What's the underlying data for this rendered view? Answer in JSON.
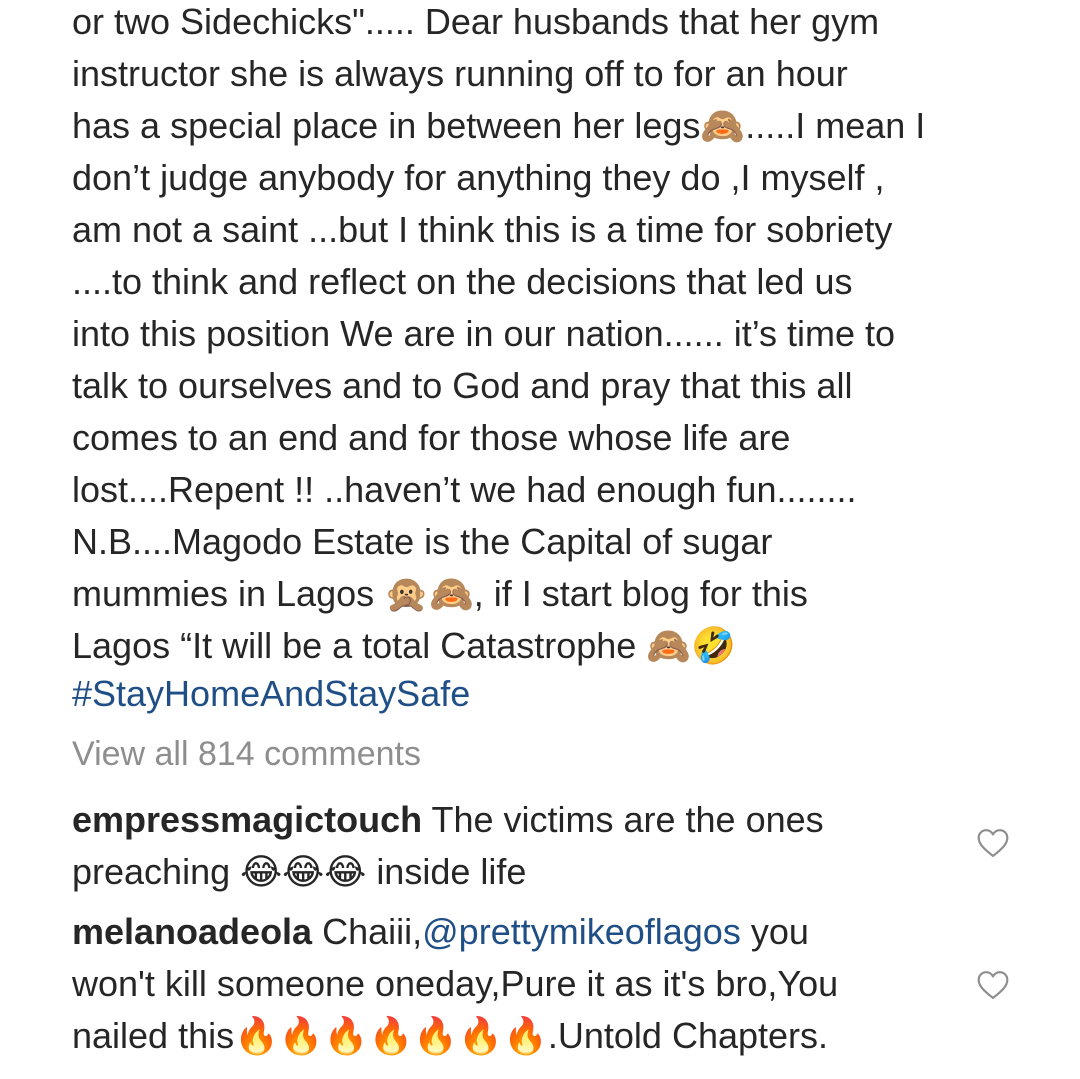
{
  "caption": {
    "lines": [
      "or two Sidechicks\"..... Dear husbands that her gym",
      "instructor she is always running off to for an hour",
      "has a special place in between her legs🙈.....I mean I",
      "don’t judge anybody for anything they do ,I myself ,",
      "am not a saint ...but I think this is a time for sobriety",
      "....to think and reflect on the decisions that led us",
      "into this position We are in our nation...... it’s time to",
      "talk to ourselves and to God and pray that this all",
      "comes to an end and for those whose life are",
      "lost....Repent !! ..haven’t we had enough fun........",
      "N.B....Magodo Estate is the Capital of sugar",
      "mummies in Lagos 🙊🙈, if I start blog for this",
      "Lagos “It will be a total Catastrophe 🙈🤣"
    ],
    "hashtag": "#StayHomeAndStaySafe"
  },
  "view_all": "View all 814 comments",
  "comments": [
    {
      "username": "empressmagictouch",
      "line1_text": " The victims are the ones",
      "line2_text": "preaching 😂😂😂 inside life"
    },
    {
      "username": "melanoadeola",
      "line1_pre": " Chaiii,",
      "mention": "@prettymikeoflagos",
      "line1_post": " you",
      "line2_text": "won't kill someone oneday,Pure it as it's bro,You",
      "line3_text": "nailed this🔥🔥🔥🔥🔥🔥🔥.Untold Chapters."
    }
  ],
  "icons": {
    "like": "heart-outline-icon"
  }
}
